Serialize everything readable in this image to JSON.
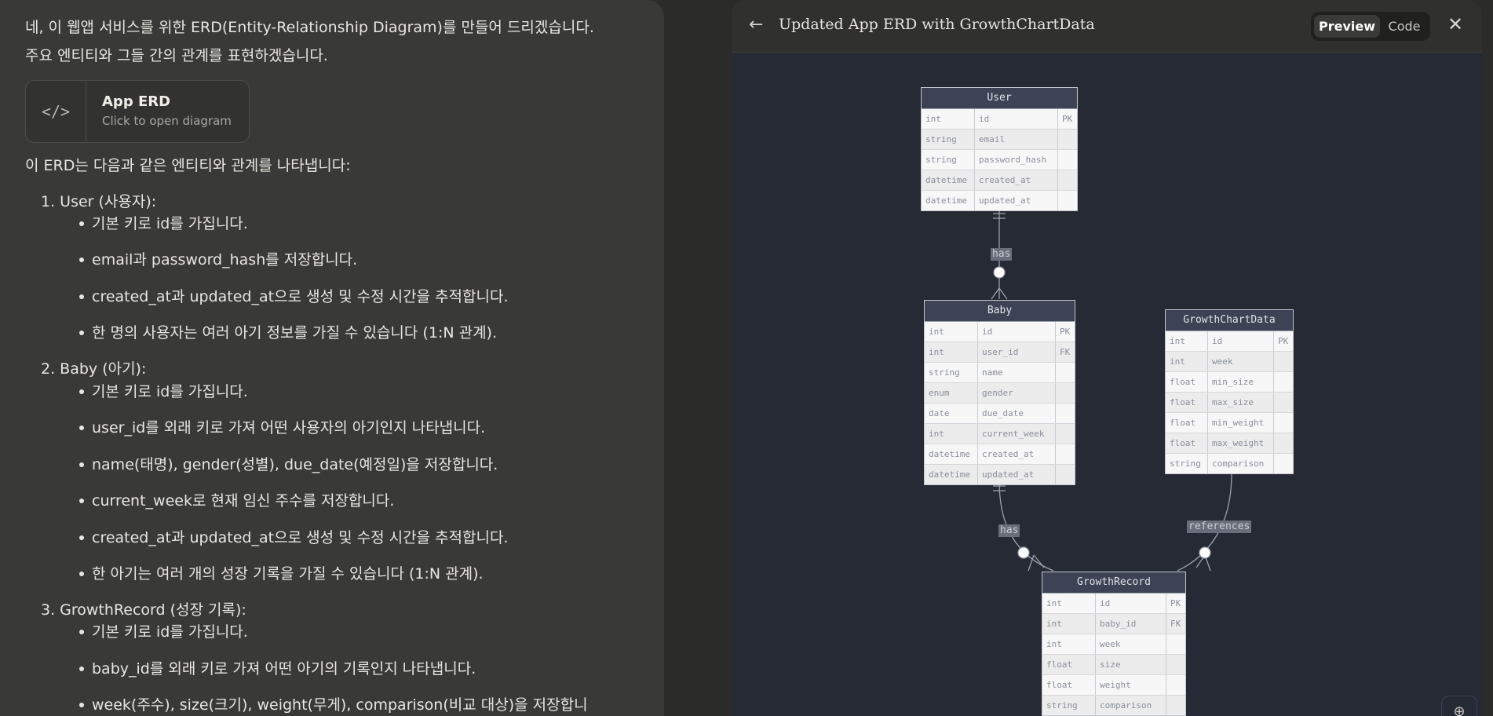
{
  "chat": {
    "intro_line1": "네, 이 웹앱 서비스를 위한 ERD(Entity-Relationship Diagram)를 만들어 드리겠습니다.",
    "intro_line2": "주요 엔티티와 그들 간의 관계를 표현하겠습니다.",
    "artifact": {
      "title": "App ERD",
      "subtitle": "Click to open diagram",
      "icon": "code-icon"
    },
    "summary": "이 ERD는 다음과 같은 엔티티와 관계를 나타냅니다:",
    "sections": [
      {
        "heading": "1. User (사용자):",
        "bullets": [
          "기본 키로 id를 가집니다.",
          "email과 password_hash를 저장합니다.",
          "created_at과 updated_at으로 생성 및 수정 시간을 추적합니다.",
          "한 명의 사용자는 여러 아기 정보를 가질 수 있습니다 (1:N 관계)."
        ]
      },
      {
        "heading": "2. Baby (아기):",
        "bullets": [
          "기본 키로 id를 가집니다.",
          "user_id를 외래 키로 가져 어떤 사용자의 아기인지 나타냅니다.",
          "name(태명), gender(성별), due_date(예정일)을 저장합니다.",
          "current_week로 현재 임신 주수를 저장합니다.",
          "created_at과 updated_at으로 생성 및 수정 시간을 추적합니다.",
          "한 아기는 여러 개의 성장 기록을 가질 수 있습니다 (1:N 관계)."
        ]
      },
      {
        "heading": "3. GrowthRecord (성장 기록):",
        "bullets": [
          "기본 키로 id를 가집니다.",
          "baby_id를 외래 키로 가져 어떤 아기의 기록인지 나타냅니다.",
          "week(주수), size(크기), weight(무게), comparison(비교 대상)을 저장합니"
        ]
      }
    ]
  },
  "panel": {
    "title": "Updated App ERD with GrowthChartData",
    "back_icon": "arrow-left-icon",
    "close_icon": "close-icon",
    "zoom_icon": "zoom-in-icon",
    "tabs": [
      "Preview",
      "Code"
    ],
    "active_tab": "Preview"
  },
  "diagram": {
    "entities": {
      "user": {
        "name": "User",
        "rows": [
          [
            "int",
            "id",
            "PK"
          ],
          [
            "string",
            "email",
            ""
          ],
          [
            "string",
            "password_hash",
            ""
          ],
          [
            "datetime",
            "created_at",
            ""
          ],
          [
            "datetime",
            "updated_at",
            ""
          ]
        ]
      },
      "baby": {
        "name": "Baby",
        "rows": [
          [
            "int",
            "id",
            "PK"
          ],
          [
            "int",
            "user_id",
            "FK"
          ],
          [
            "string",
            "name",
            ""
          ],
          [
            "enum",
            "gender",
            ""
          ],
          [
            "date",
            "due_date",
            ""
          ],
          [
            "int",
            "current_week",
            ""
          ],
          [
            "datetime",
            "created_at",
            ""
          ],
          [
            "datetime",
            "updated_at",
            ""
          ]
        ]
      },
      "growthchart": {
        "name": "GrowthChartData",
        "rows": [
          [
            "int",
            "id",
            "PK"
          ],
          [
            "int",
            "week",
            ""
          ],
          [
            "float",
            "min_size",
            ""
          ],
          [
            "float",
            "max_size",
            ""
          ],
          [
            "float",
            "min_weight",
            ""
          ],
          [
            "float",
            "max_weight",
            ""
          ],
          [
            "string",
            "comparison",
            ""
          ]
        ]
      },
      "growthrecord": {
        "name": "GrowthRecord",
        "rows": [
          [
            "int",
            "id",
            "PK"
          ],
          [
            "int",
            "baby_id",
            "FK"
          ],
          [
            "int",
            "week",
            ""
          ],
          [
            "float",
            "size",
            ""
          ],
          [
            "float",
            "weight",
            ""
          ],
          [
            "string",
            "comparison",
            ""
          ]
        ]
      }
    },
    "relations": {
      "user_baby": "has",
      "baby_record": "has",
      "chart_record": "references"
    }
  },
  "colors": {
    "chat_bg": "#393937",
    "canvas_bg": "#262a35",
    "entity_header": "#3d4254",
    "text": "#e8e6e0"
  }
}
